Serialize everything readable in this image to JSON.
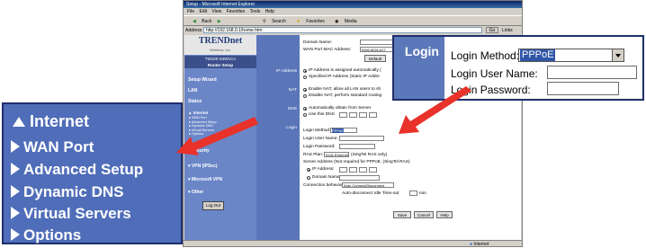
{
  "browser": {
    "title": "Setup - Microsoft Internet Explorer",
    "menu": [
      "File",
      "Edit",
      "View",
      "Favorites",
      "Tools",
      "Help"
    ],
    "toolbar": [
      "Back",
      "Search",
      "Favorites",
      "Media"
    ],
    "address_label": "Address",
    "address_value": "http://192.168.0.1/home.htm",
    "go_label": "Go",
    "links_label": "Links",
    "status_right": "Internet"
  },
  "router": {
    "logo": "TRENDnet",
    "logo_sub": "Wireless, Inc.",
    "model_line1": "TW100-S4W1CA",
    "model_line2": "Router Setup",
    "nav": {
      "setup_wizard": "Setup Wizard",
      "lan": "LAN",
      "status": "Status",
      "internet": "Internet",
      "internet_sub": [
        "WAN Port",
        "Advanced Setup",
        "Dynamic DNS",
        "Virtual Servers",
        "Options"
      ],
      "security": "Security",
      "vpn": "VPN (IPSec)",
      "microsoft_vpn": "Microsoft VPN",
      "other": "Other",
      "logout": "Log Out"
    },
    "labels": {
      "ip_address": "IP Address",
      "nat": "NAT",
      "dns": "DNS",
      "login": "Login"
    },
    "content": {
      "domain_name": "Domain Name:",
      "wan_mac_label": "WAN Port MAC Address:",
      "wan_mac_value": "00e0.802e.b27",
      "default_btn": "Default",
      "ip_auto": "IP Address is assigned automatically (",
      "ip_static": "Specified IP Address (Static IP Addre",
      "nat_enable": "Enable NAT, allow all LAN users to sh",
      "nat_disable": "Disable NAT, perform standard routing",
      "dns_auto": "Automatically obtain from Server",
      "dns_use": "Use this DNS",
      "login_method": "Login Method:",
      "login_method_value": "PPPoE",
      "login_user": "Login User Name:",
      "login_pass": "Login Password:",
      "ras_plan": "RAS Plan:",
      "ras_plan_value": "512k Ethernet",
      "ras_note": "(SingTel RAS only)",
      "server_addr": "Server Address (Not required for PPPoE, (SingTel RAS)",
      "ip_address_opt": "IP Address:",
      "domain_name_opt": "Domain Name:",
      "conn_behavior": "Connection behavior",
      "conn_value": "Auto Connect/Disconnect",
      "auto_disconnect": "Auto-disconnect Idle Time-out",
      "min": "min",
      "save": "Save",
      "cancel": "Cancel",
      "help": "Help"
    }
  },
  "left_zoom": {
    "header": "Internet",
    "items": [
      "WAN Port",
      "Advanced Setup",
      "Dynamic DNS",
      "Virtual Servers",
      "Options"
    ]
  },
  "right_zoom": {
    "section": "Login",
    "login_method_label": "Login Method:",
    "login_method_value": "PPPoE",
    "user_label": "Login User Name:",
    "password_label": "Login Password:"
  },
  "colors": {
    "arrow": "#e8322a",
    "sidebar": "#6b86c7",
    "zoom_panel": "#4f6db8"
  }
}
